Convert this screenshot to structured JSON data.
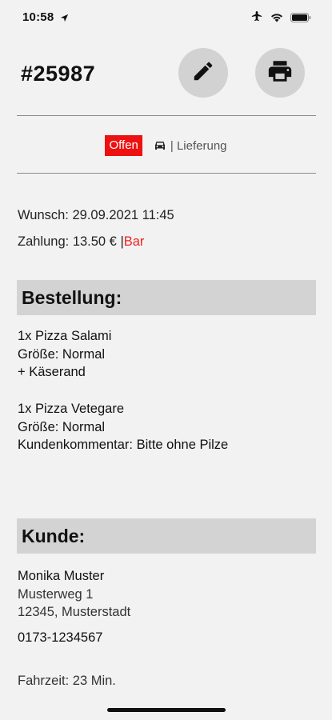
{
  "statusbar": {
    "time": "10:58"
  },
  "header": {
    "order_number": "#25987"
  },
  "status": {
    "badge": "Offen",
    "delivery": "| Lieferung"
  },
  "info": {
    "wunsch_label": "Wunsch:",
    "wunsch_value": "29.09.2021 11:45",
    "zahlung_label": "Zahlung:",
    "zahlung_value": "13.50 € |",
    "zahlung_method": "Bar"
  },
  "order": {
    "title": "Bestellung:",
    "items": [
      {
        "line1": "1x Pizza Salami",
        "line2": "Größe: Normal",
        "line3": "+ Käserand"
      },
      {
        "line1": "1x Pizza Vetegare",
        "line2": "Größe: Normal",
        "line3": "Kundenkommentar: Bitte ohne Pilze"
      }
    ]
  },
  "customer": {
    "title": "Kunde:",
    "name": "Monika Muster",
    "street": "Musterweg 1",
    "city": "12345, Musterstadt",
    "phone": "0173-1234567",
    "drive_time": "Fahrzeit: 23 Min."
  },
  "colors": {
    "accent_red": "#ee1111",
    "section_gray": "#d3d3d3",
    "button_gray": "#d2d2d2"
  }
}
